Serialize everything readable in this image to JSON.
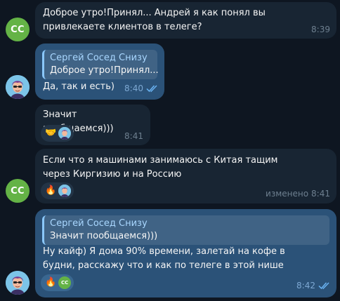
{
  "colors": {
    "background": "#0e1621",
    "incoming_bubble": "#182533",
    "outgoing_bubble": "#2b5278",
    "cc_avatar": "#64b346",
    "read_check": "#6ab3f3"
  },
  "contact": {
    "initials": "СС"
  },
  "messages": [
    {
      "text": "Доброе утро!Принял... Андрей я как понял вы привлекаете клиентов в телеге?",
      "time": "8:39"
    },
    {
      "quote_author": "Сергей Сосед Снизу",
      "quote_text": "Доброе утро!Принял...",
      "text": "Да, так и есть)",
      "time": "8:40",
      "status_icon": "double-check-icon"
    },
    {
      "text": "Значит пообщаемся)))",
      "reaction_emoji": "🤝",
      "time": "8:41"
    },
    {
      "text": "Если что я машинами занимаюсь с Китая тащим через Киргизию и на Россию",
      "reaction_emoji": "🔥",
      "edited_label": "изменено",
      "time": "8:41"
    },
    {
      "quote_author": "Сергей Сосед Снизу",
      "quote_text": "Значит пообщаемся)))",
      "text": "Ну кайф) Я дома 90% времени, залетай на кофе в будни, расскажу что и как по телеге в этой нише",
      "reaction_emoji": "🔥",
      "time": "8:42",
      "status_icon": "double-check-icon"
    }
  ]
}
